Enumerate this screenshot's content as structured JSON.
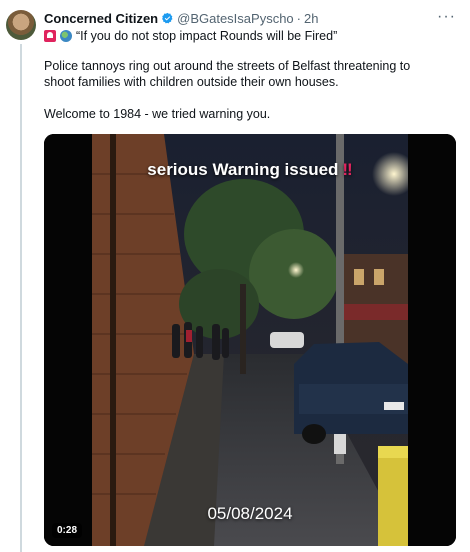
{
  "tweet": {
    "author_name": "Concerned Citizen",
    "handle": "@BGatesIsaPyscho",
    "separator": "·",
    "time": "2h",
    "more_label": "···",
    "line1_quote": "“If you do not stop impact Rounds will be Fired”",
    "paragraph2": "Police tannoys ring out around the streets of Belfast threatening to shoot families with children outside their own houses.",
    "paragraph3": "Welcome to 1984 - we tried warning you."
  },
  "media": {
    "overlay_title": "serious Warning issued",
    "overlay_bang": "‼",
    "overlay_date": "05/08/2024",
    "duration": "0:28"
  },
  "icons": {
    "verified": "verified-badge-icon",
    "emoji1": "alarm-icon",
    "emoji2": "globe-icon"
  },
  "colors": {
    "verified": "#1d9bf0",
    "muted": "#536471",
    "text": "#0f1419"
  }
}
